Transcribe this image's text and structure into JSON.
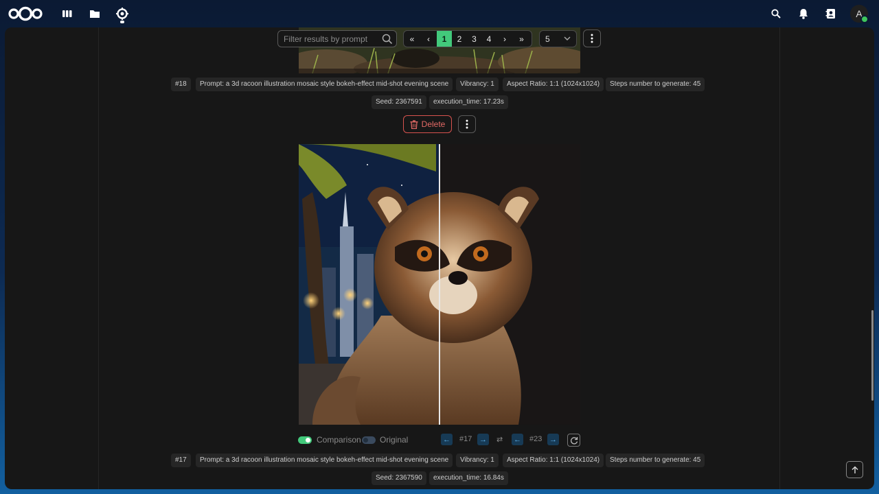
{
  "header": {
    "logo": "nextcloud-logo",
    "apps": [
      "dashboard-icon",
      "files-icon",
      "ai-image-app-icon"
    ],
    "right_icons": [
      "search-icon",
      "notifications-icon",
      "contacts-icon"
    ],
    "avatar_letter": "A"
  },
  "toolbar": {
    "filter_placeholder": "Filter results by prompt",
    "pages": [
      "1",
      "2",
      "3",
      "4"
    ],
    "active_page": "1",
    "per_page": "5"
  },
  "result18": {
    "id": "#18",
    "prompt": "Prompt: a 3d racoon illustration mosaic style bokeh-effect mid-shot evening scene",
    "vibrancy": "Vibrancy: 1",
    "aspect": "Aspect Ratio: 1:1 (1024x1024)",
    "steps": "Steps number to generate: 45",
    "seed": "Seed: 2367591",
    "exec": "execution_time: 17.23s",
    "delete_label": "Delete"
  },
  "comparison": {
    "comparison_label": "Comparison",
    "original_label": "Original",
    "left_num": "#17",
    "right_num": "#23"
  },
  "result17": {
    "id": "#17",
    "prompt": "Prompt: a 3d racoon illustration mosaic style bokeh-effect mid-shot evening scene",
    "vibrancy": "Vibrancy: 1",
    "aspect": "Aspect Ratio: 1:1 (1024x1024)",
    "steps": "Steps number to generate: 45",
    "seed": "Seed: 2367590",
    "exec": "execution_time: 16.84s"
  },
  "colors": {
    "accent_green": "#42c97b",
    "delete_red": "#d9534f",
    "nav_blue": "#5eb2ec"
  }
}
